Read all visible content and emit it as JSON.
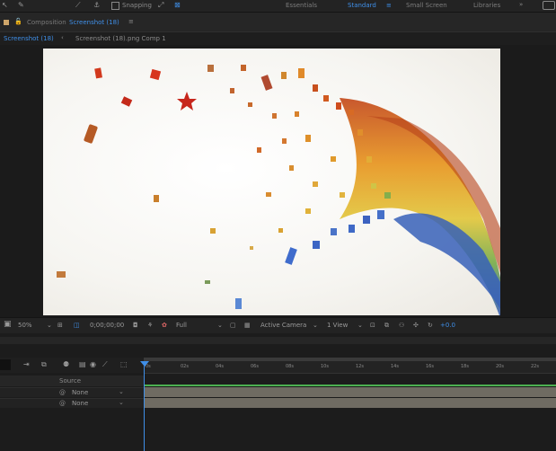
{
  "toolbar": {
    "snapping_label": "Snapping",
    "workspaces": [
      "Essentials",
      "Standard",
      "Small Screen",
      "Libraries"
    ],
    "active_workspace": "Standard"
  },
  "panel": {
    "title_prefix": "Composition",
    "title_name": "Screenshot (18)",
    "menu_icon": "≡"
  },
  "tabs": {
    "comp_tab": "Screenshot (18)",
    "breadcrumb": "Screenshot (18).png Comp 1"
  },
  "viewer_bar": {
    "zoom": "50%",
    "timecode": "0;00;00;00",
    "resolution": "Full",
    "camera": "Active Camera",
    "views": "1 View",
    "exposure": "+0.0"
  },
  "timeline": {
    "column_header": "Source",
    "ruler_ticks": [
      "0s",
      "02s",
      "04s",
      "06s",
      "08s",
      "10s",
      "12s",
      "14s",
      "16s",
      "18s",
      "20s",
      "22s"
    ],
    "layers": [
      {
        "parent": "None"
      },
      {
        "parent": "None"
      }
    ]
  },
  "colors": {
    "accent": "#3f8fe8",
    "panel_bg": "#1d1d1d",
    "layer_bar": "#6f6b62",
    "work_area": "#4caf50"
  }
}
